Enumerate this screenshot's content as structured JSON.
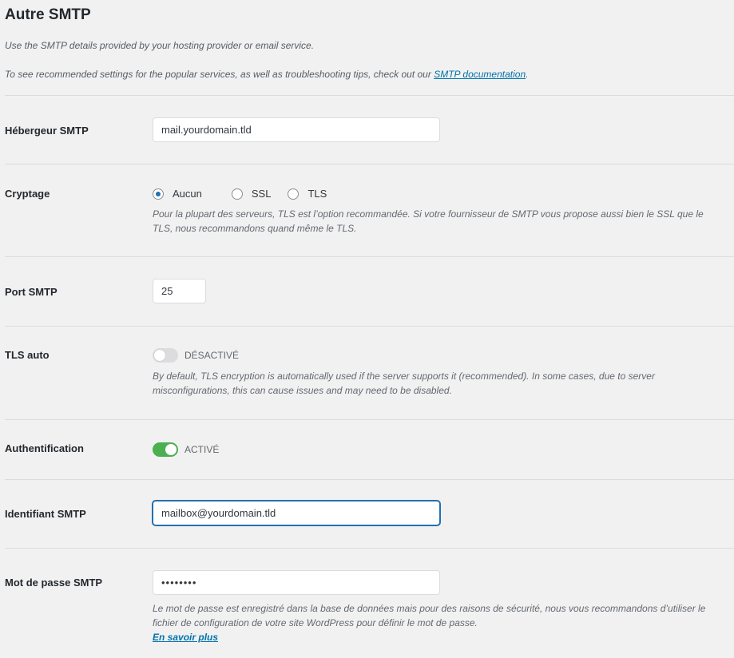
{
  "section": {
    "title": "Autre SMTP",
    "intro": "Use the SMTP details provided by your hosting provider or email service.",
    "docs_prefix": "To see recommended settings for the popular services, as well as troubleshooting tips, check out our ",
    "docs_link": "SMTP documentation",
    "docs_suffix": "."
  },
  "fields": {
    "host": {
      "label": "Hébergeur SMTP",
      "value": "mail.yourdomain.tld"
    },
    "encryption": {
      "label": "Cryptage",
      "options": [
        "Aucun",
        "SSL",
        "TLS"
      ],
      "selected": "Aucun",
      "help": "Pour la plupart des serveurs, TLS est l’option recommandée. Si votre fournisseur de SMTP vous propose aussi bien le SSL que le TLS, nous recommandons quand même le TLS."
    },
    "port": {
      "label": "Port SMTP",
      "value": "25"
    },
    "autotls": {
      "label": "TLS auto",
      "state": "DÉSACTIVÉ",
      "enabled": false,
      "help": "By default, TLS encryption is automatically used if the server supports it (recommended). In some cases, due to server misconfigurations, this can cause issues and may need to be disabled."
    },
    "auth": {
      "label": "Authentification",
      "state": "ACTIVÉ",
      "enabled": true
    },
    "username": {
      "label": "Identifiant SMTP",
      "value": "mailbox@yourdomain.tld"
    },
    "password": {
      "label": "Mot de passe SMTP",
      "value": "••••••••",
      "help": "Le mot de passe est enregistré dans la base de données mais pour des raisons de sécurité, nous vous recommandons d’utiliser le fichier de configuration de votre site WordPress pour définir le mot de passe.",
      "link": "En savoir plus"
    }
  },
  "colors": {
    "accent": "#2271b1",
    "toggle_on": "#4caf50",
    "link": "#0073aa"
  }
}
